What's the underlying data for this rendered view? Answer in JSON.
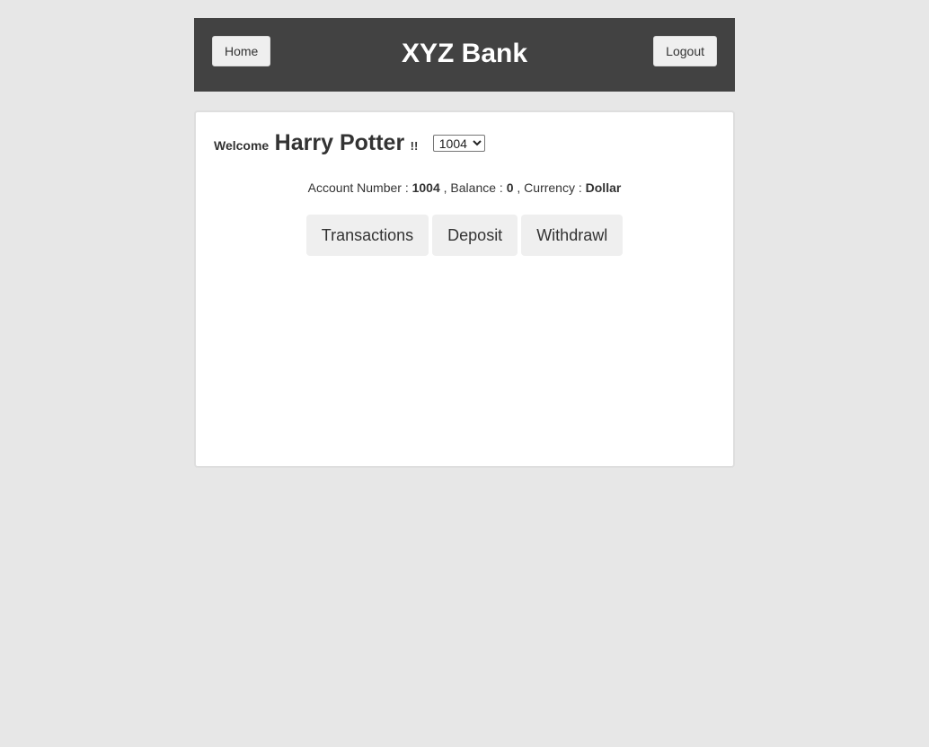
{
  "header": {
    "title": "XYZ Bank",
    "home_label": "Home",
    "logout_label": "Logout"
  },
  "welcome": {
    "greeting": "Welcome",
    "user_name": "Harry Potter",
    "suffix": "!!",
    "account_select": {
      "selected": "1004",
      "options": [
        "1004"
      ]
    }
  },
  "account_info": {
    "account_number_label": "Account Number :",
    "account_number": "1004",
    "balance_label": ", Balance :",
    "balance": "0",
    "currency_label": ", Currency :",
    "currency": "Dollar"
  },
  "tabs": [
    {
      "label": "Transactions"
    },
    {
      "label": "Deposit"
    },
    {
      "label": "Withdrawl"
    }
  ],
  "colors": {
    "page_bg": "#e7e7e7",
    "header_bg": "#424242",
    "button_bg": "#efefef",
    "card_bg": "#ffffff"
  }
}
